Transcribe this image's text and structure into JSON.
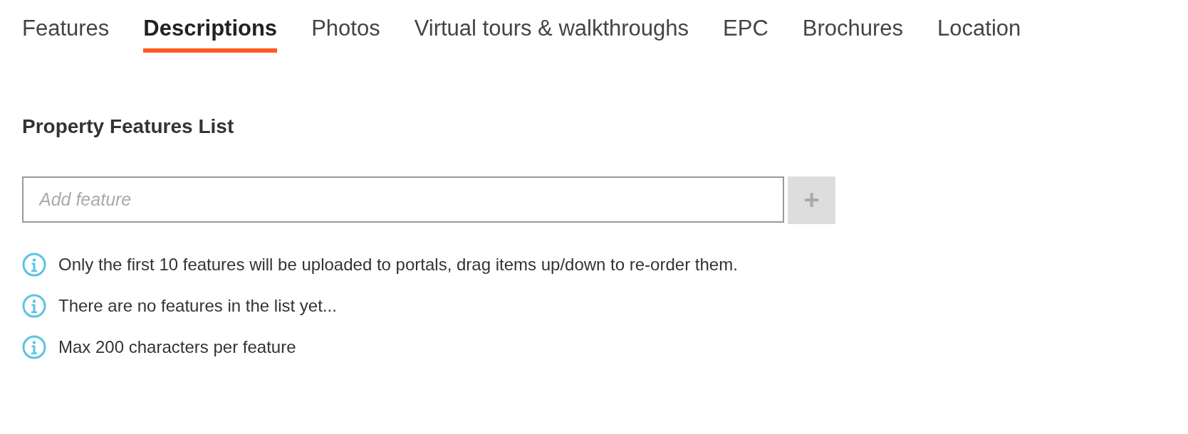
{
  "tabs": [
    {
      "label": "Features",
      "selected": false
    },
    {
      "label": "Descriptions",
      "selected": true
    },
    {
      "label": "Photos",
      "selected": false
    },
    {
      "label": "Virtual tours & walkthroughs",
      "selected": false
    },
    {
      "label": "EPC",
      "selected": false
    },
    {
      "label": "Brochures",
      "selected": false
    },
    {
      "label": "Location",
      "selected": false
    }
  ],
  "section": {
    "title": "Property Features List",
    "input": {
      "placeholder": "Add feature"
    },
    "add_button": {
      "label": "+",
      "disabled": true
    },
    "notes": [
      "Only the first 10 features will be uploaded to portals, drag items up/down to re-order them.",
      "There are no features in the list yet...",
      "Max 200 characters per feature"
    ]
  }
}
